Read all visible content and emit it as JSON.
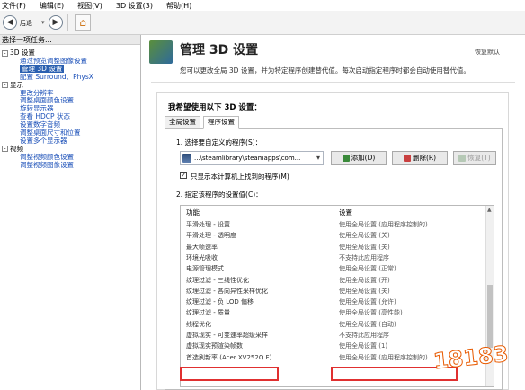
{
  "menu": [
    "文件(F)",
    "编辑(E)",
    "视图(V)",
    "3D 设置(3)",
    "帮助(H)"
  ],
  "toolbar": {
    "back_label": "后退"
  },
  "left": {
    "header": "选择一项任务...",
    "tree": [
      {
        "text": "3D 设置",
        "type": "cat",
        "box": "-"
      },
      {
        "text": "通过预览调整图像设置",
        "type": "link"
      },
      {
        "text": "管理 3D 设置",
        "type": "sel"
      },
      {
        "text": "配置 Surround、PhysX",
        "type": "link"
      },
      {
        "text": "显示",
        "type": "cat",
        "box": "-"
      },
      {
        "text": "更改分辨率",
        "type": "link"
      },
      {
        "text": "调整桌面颜色设置",
        "type": "link"
      },
      {
        "text": "旋转显示器",
        "type": "link"
      },
      {
        "text": "查看 HDCP 状态",
        "type": "link"
      },
      {
        "text": "设置数字音频",
        "type": "link"
      },
      {
        "text": "调整桌面尺寸和位置",
        "type": "link"
      },
      {
        "text": "设置多个显示器",
        "type": "link"
      },
      {
        "text": "视频",
        "type": "cat",
        "box": "-"
      },
      {
        "text": "调整视频颜色设置",
        "type": "link"
      },
      {
        "text": "调整视频图像设置",
        "type": "link"
      }
    ]
  },
  "main": {
    "title": "管理 3D 设置",
    "restore": "恢复默认",
    "subtitle": "您可以更改全局 3D 设置，并为特定程序创建替代值。每次启动指定程序时都会自动使用替代值。",
    "heading": "我希望使用以下 3D 设置：",
    "tabs": [
      "全局设置",
      "程序设置"
    ],
    "step1": "1. 选择要自定义的程序(S)：",
    "program": "...\\steamlibrary\\steamapps\\com...",
    "add_btn": "添加(D)",
    "remove_btn": "删除(R)",
    "restore_btn": "恢复(T)",
    "checkbox_label": "只显示本计算机上找到的程序(M)",
    "checkbox_checked": true,
    "step2": "2. 指定该程序的设置值(C)：",
    "col_feature": "功能",
    "col_setting": "设置",
    "rows": [
      {
        "f": "平滑处理 - 设置",
        "s": "使用全局设置 (应用程序控制的)"
      },
      {
        "f": "平滑处理 - 透明度",
        "s": "使用全局设置 (关)"
      },
      {
        "f": "最大帧速率",
        "s": "使用全局设置 (关)"
      },
      {
        "f": "环境光吸收",
        "s": "不支持此应用程序"
      },
      {
        "f": "电源管理模式",
        "s": "使用全局设置 (正常)"
      },
      {
        "f": "纹理过滤 - 三线性优化",
        "s": "使用全局设置 (开)"
      },
      {
        "f": "纹理过滤 - 各向异性采样优化",
        "s": "使用全局设置 (关)"
      },
      {
        "f": "纹理过滤 - 负 LOD 偏移",
        "s": "使用全局设置 (允许)"
      },
      {
        "f": "纹理过滤 - 质量",
        "s": "使用全局设置 (高性能)"
      },
      {
        "f": "线程优化",
        "s": "使用全局设置 (自动)"
      },
      {
        "f": "虚拟现实 - 可变速率超级采样",
        "s": "不支持此应用程序"
      },
      {
        "f": "虚拟现实预渲染帧数",
        "s": "使用全局设置 (1)"
      },
      {
        "f": "首选刷新率 (Acer XV252Q F)",
        "s": "使用全局设置 (应用程序控制的)"
      }
    ]
  },
  "watermark": "18183"
}
